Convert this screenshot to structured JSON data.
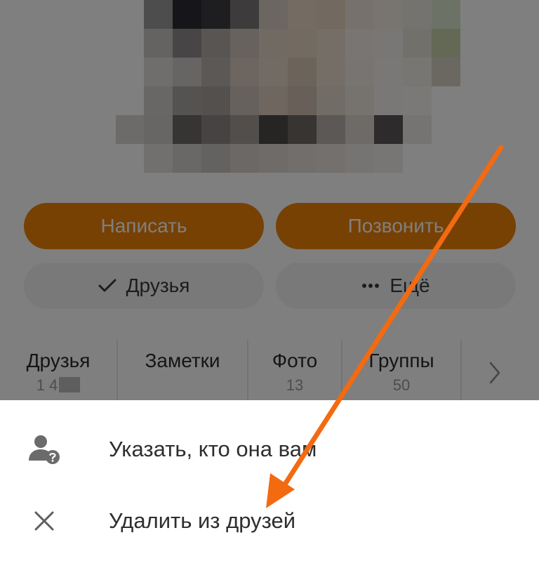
{
  "profile": {
    "actions": {
      "write_label": "Написать",
      "call_label": "Позвонить",
      "friends_label": "Друзья",
      "more_label": "Ещё"
    },
    "stats": [
      {
        "label": "Друзья",
        "count": "1 4"
      },
      {
        "label": "Заметки",
        "count": ""
      },
      {
        "label": "Фото",
        "count": "13"
      },
      {
        "label": "Группы",
        "count": "50"
      }
    ]
  },
  "sheet": {
    "items": [
      {
        "label": "Указать, кто она вам",
        "icon": "person-question-icon"
      },
      {
        "label": "Удалить из друзей",
        "icon": "close-icon"
      }
    ]
  },
  "colors": {
    "accent": "#ee8208",
    "annotation_arrow": "#f36a10"
  }
}
